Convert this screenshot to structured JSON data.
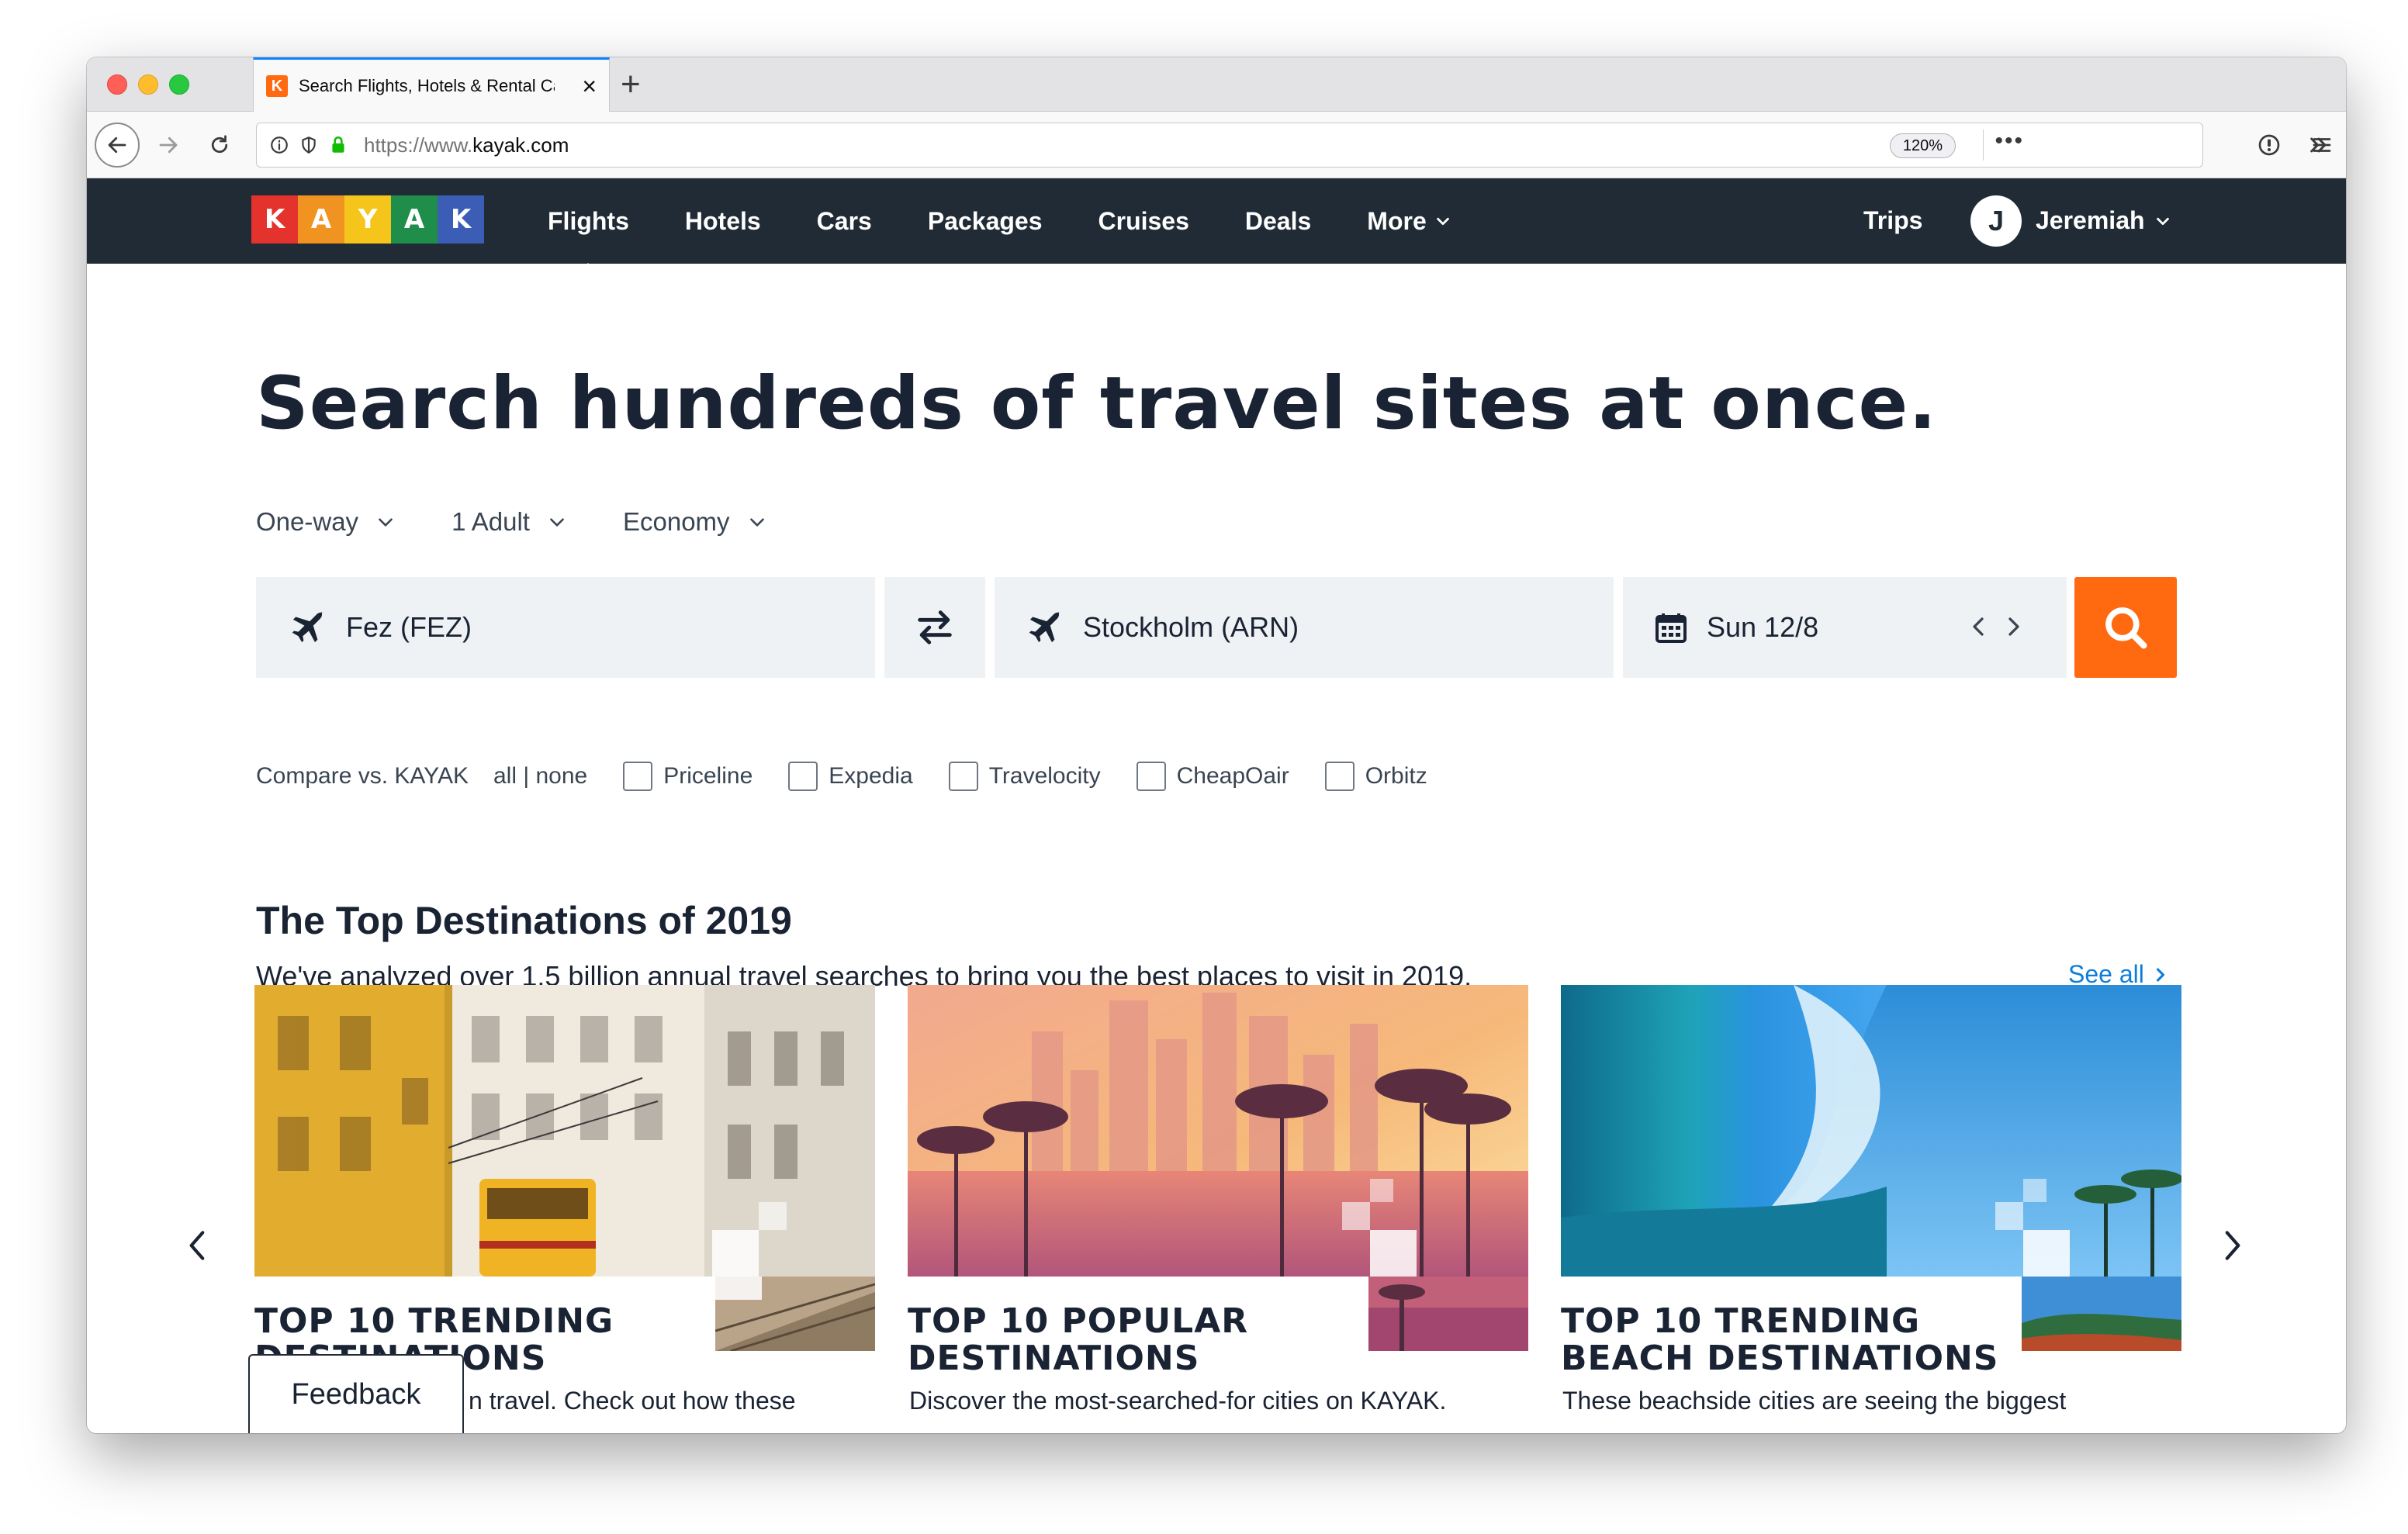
{
  "browser": {
    "tab_title": "Search Flights, Hotels & Rental Cars | KAYAK",
    "tab_favicon_letter": "K",
    "url_prefix": "https://www.",
    "url_domain": "kayak.com",
    "zoom": "120%",
    "page_actions": "•••"
  },
  "header": {
    "logo_letters": [
      "K",
      "A",
      "Y",
      "A",
      "K"
    ],
    "logo_colors": [
      "#e4322c",
      "#f19320",
      "#f6c51c",
      "#1f8e4a",
      "#3b5db5"
    ],
    "nav": [
      {
        "label": "Flights",
        "active": true
      },
      {
        "label": "Hotels"
      },
      {
        "label": "Cars"
      },
      {
        "label": "Packages"
      },
      {
        "label": "Cruises"
      },
      {
        "label": "Deals"
      },
      {
        "label": "More",
        "has_dropdown": true
      }
    ],
    "trips": "Trips",
    "avatar_initial": "J",
    "username": "Jeremiah"
  },
  "hero": {
    "headline": "Search hundreds of travel sites at once."
  },
  "search": {
    "trip_type": "One-way",
    "travelers": "1 Adult",
    "cabin": "Economy",
    "origin": "Fez (FEZ)",
    "destination": "Stockholm (ARN)",
    "date": "Sun 12/8",
    "compare_label": "Compare vs. KAYAK",
    "all_none": "all | none",
    "compare_sites": [
      "Priceline",
      "Expedia",
      "Travelocity",
      "CheapOair",
      "Orbitz"
    ]
  },
  "destinations": {
    "title": "The Top Destinations of 2019",
    "subtitle": "We've analyzed over 1.5 billion annual travel searches to bring you the best places to visit in 2019.",
    "see_all": "See all",
    "cards": [
      {
        "title_line1": "TOP 10 TRENDING",
        "title_line2": "DESTINATIONS",
        "desc": "n travel. Check out how these"
      },
      {
        "title_line1": "TOP 10 POPULAR",
        "title_line2": "DESTINATIONS",
        "desc": "Discover the most-searched-for cities on KAYAK."
      },
      {
        "title_line1": "TOP 10 TRENDING",
        "title_line2": "BEACH DESTINATIONS",
        "desc": "These beachside cities are seeing the biggest"
      }
    ]
  },
  "feedback": "Feedback",
  "colors": {
    "brand_orange": "#ff690f",
    "header_bg": "#212b35",
    "link_blue": "#0d7ddc"
  }
}
